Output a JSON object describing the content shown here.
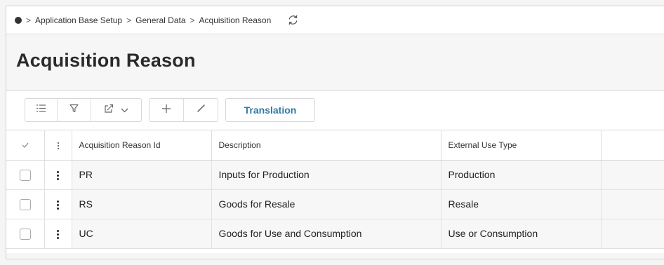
{
  "breadcrumb": {
    "items": [
      "Application Base Setup",
      "General Data",
      "Acquisition Reason"
    ],
    "separator": ">"
  },
  "page": {
    "title": "Acquisition Reason"
  },
  "toolbar": {
    "translation_label": "Translation"
  },
  "table": {
    "columns": [
      "Acquisition Reason Id",
      "Description",
      "External Use Type"
    ],
    "rows": [
      {
        "id": "PR",
        "description": "Inputs for Production",
        "external_use_type": "Production"
      },
      {
        "id": "RS",
        "description": "Goods for Resale",
        "external_use_type": "Resale"
      },
      {
        "id": "UC",
        "description": "Goods for Use and Consumption",
        "external_use_type": "Use or Consumption"
      }
    ]
  },
  "colors": {
    "accent": "#2d7aa8",
    "row_bg": "#f7f7f7"
  },
  "icons": [
    "home-dot-icon",
    "refresh-icon",
    "list-settings-icon",
    "filter-icon",
    "export-icon",
    "chevron-down-icon",
    "add-icon",
    "edit-icon",
    "select-all-check-icon",
    "kebab-icon"
  ]
}
